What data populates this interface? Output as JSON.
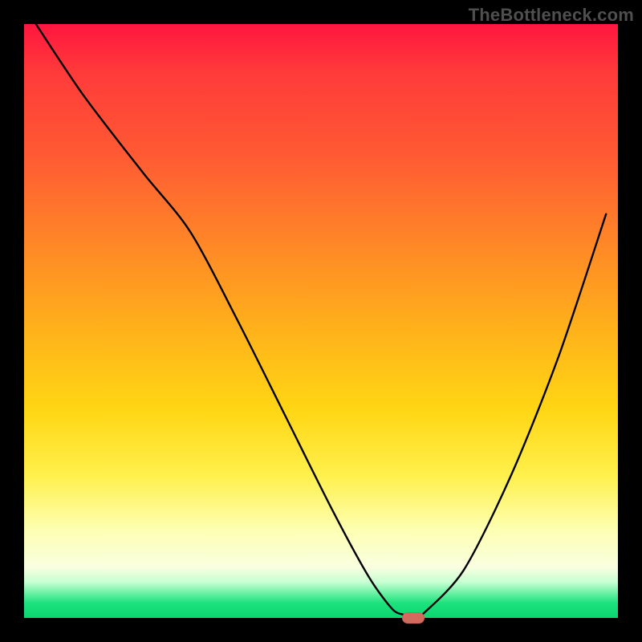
{
  "watermark": "TheBottleneck.com",
  "chart_data": {
    "type": "line",
    "title": "",
    "xlabel": "",
    "ylabel": "",
    "xlim": [
      0,
      100
    ],
    "ylim": [
      0,
      100
    ],
    "x": [
      2,
      10,
      20,
      28,
      36,
      44,
      52,
      58,
      62,
      64,
      65,
      66,
      67,
      74,
      82,
      90,
      98
    ],
    "values": [
      100,
      88,
      75,
      65,
      50,
      34,
      18,
      7,
      1.5,
      0.5,
      0.0,
      0.0,
      0.5,
      8,
      24,
      44,
      68
    ],
    "flat_region_x": [
      64,
      67
    ],
    "marker": {
      "x": 65.5,
      "y": 0.0,
      "color": "#d46a5e"
    },
    "colors": {
      "gradient_top": "#ff163f",
      "gradient_mid": "#ffd614",
      "gradient_bottom": "#0bd66f",
      "curve": "#000000",
      "frame": "#000000"
    }
  }
}
